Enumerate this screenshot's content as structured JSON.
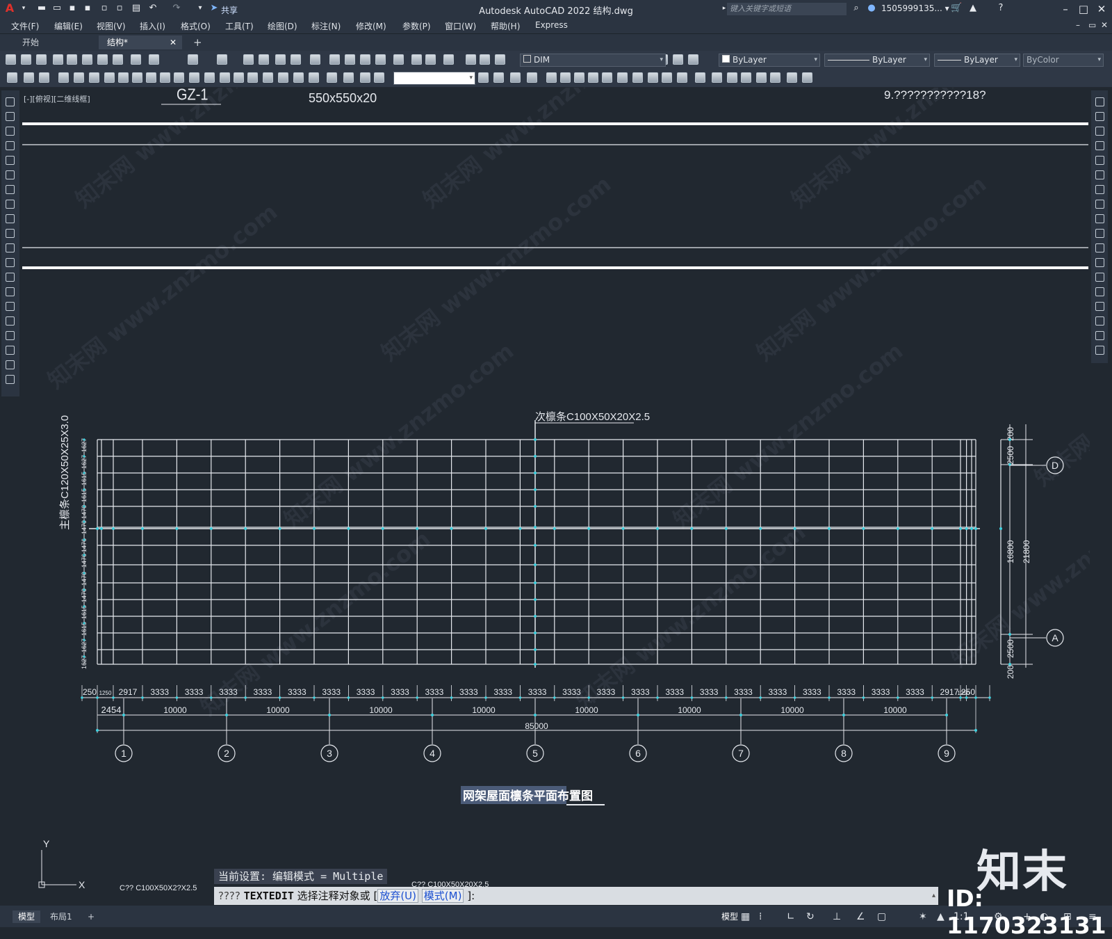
{
  "window": {
    "title": "Autodesk AutoCAD 2022    结构.dwg",
    "search_placeholder": "键入关键字或短语",
    "user": "1505999135... ▾",
    "share_label": "共享"
  },
  "menu": [
    "文件(F)",
    "编辑(E)",
    "视图(V)",
    "插入(I)",
    "格式(O)",
    "工具(T)",
    "绘图(D)",
    "标注(N)",
    "修改(M)",
    "参数(P)",
    "窗口(W)",
    "帮助(H)",
    "Express"
  ],
  "tabs": {
    "start": "开始",
    "active": "结构*",
    "close": "✕",
    "add": "+"
  },
  "toolbar": {
    "dimstyle": "DIM",
    "color": "ByLayer",
    "linetype": "ByLayer",
    "lineweight": "ByLayer",
    "plotstyle": "ByColor"
  },
  "viewport_label": "[-][俯视][二维线框]",
  "drawing": {
    "top_texts": {
      "gz": "GZ-1",
      "size": "550x550x20",
      "corner": "9.???????????18?"
    },
    "secondary_purlin_label": "次檩条C100X50X20X2.5",
    "main_purlin_label": "主檩条C120X50X25X3.0",
    "left_dims": [
      "1627",
      "1627",
      "1615",
      "1615",
      "1470",
      "1470",
      "1476",
      "1476",
      "1470",
      "1470",
      "1615",
      "1615",
      "1627",
      "1627"
    ],
    "right_dims": {
      "top_small": "200",
      "top": "2500",
      "middle": "16800",
      "total": "21800",
      "bottom": "2500",
      "bottom_small": "200"
    },
    "bottom_dims": [
      "250",
      "1250",
      "2917",
      "3333",
      "3333",
      "3333",
      "3333",
      "3333",
      "3333",
      "3333",
      "3333",
      "3333",
      "3333",
      "3333",
      "3333",
      "3333",
      "3333",
      "3333",
      "3333",
      "3333",
      "3333",
      "3333",
      "3333",
      "3333",
      "3333",
      "3333",
      "2917",
      "1250",
      "250"
    ],
    "grid_spacing_first": "2454",
    "grid_spacing": [
      "10000",
      "10000",
      "10000",
      "10000",
      "10000",
      "10000",
      "10000",
      "10000"
    ],
    "total_length": "85000",
    "axis_numbers": [
      "1",
      "2",
      "3",
      "4",
      "5",
      "6",
      "7",
      "8",
      "9"
    ],
    "axis_letters": [
      "D",
      "A"
    ],
    "plan_title": "网架屋面檩条平面布置图"
  },
  "command": {
    "history": "当前设置: 编辑模式 = Multiple",
    "prompt_prefix": "????",
    "command_name": "TEXTEDIT",
    "prompt_text": "选择注释对象或",
    "opt_undo": "放弃(U)",
    "opt_mode": "模式(M)",
    "prompt_end": "]:",
    "bg_text_left": "C?? C100X50X2?X2.5",
    "bg_text_right": "C?? C100X50X20X2.5"
  },
  "ucs": {
    "x": "X",
    "y": "Y"
  },
  "status": {
    "model_tab": "模型",
    "layout_tab": "布局1",
    "add": "+",
    "model_btn": "模型",
    "scale": "1:1"
  },
  "watermark": {
    "brand": "知末",
    "id": "ID: 1170323131",
    "site": "知末网 www.znzmo.com"
  },
  "colors": {
    "background": "#212830",
    "panel": "#2b3441",
    "cyan": "#3fd2e0",
    "line": "#e6e9ee"
  }
}
